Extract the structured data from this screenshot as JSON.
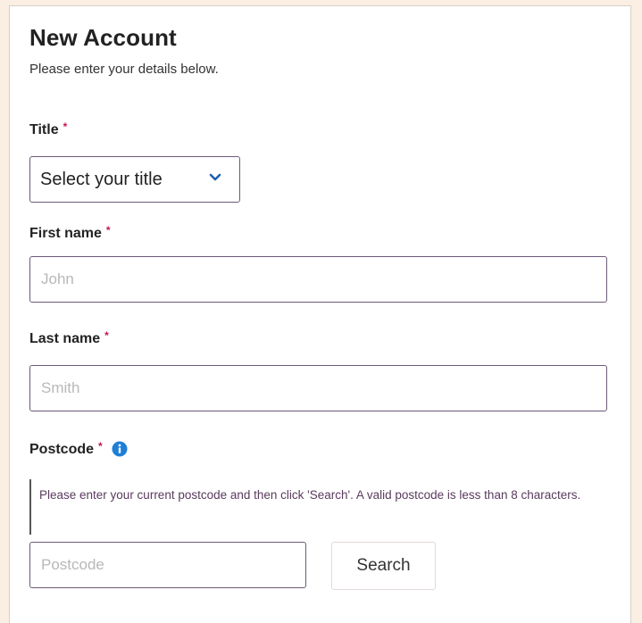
{
  "header": {
    "title": "New Account",
    "subtitle": "Please enter your details below."
  },
  "required_marker": "*",
  "form": {
    "title_field": {
      "label": "Title",
      "selected": "Select your title"
    },
    "first_name": {
      "label": "First name",
      "value": "",
      "placeholder": "John"
    },
    "last_name": {
      "label": "Last name",
      "value": "",
      "placeholder": "Smith"
    },
    "postcode": {
      "label": "Postcode",
      "hint": "Please enter your current postcode and then click 'Search'. A valid postcode is less than 8 characters.",
      "value": "",
      "placeholder": "Postcode",
      "search_label": "Search"
    }
  },
  "icons": {
    "dropdown": "chevron-down-icon",
    "info": "info-icon"
  },
  "colors": {
    "background": "#fbeee2",
    "required": "#c2174c",
    "info": "#1f7fd6",
    "chevron": "#1f5fb5",
    "hint_text": "#5a3a5e"
  }
}
